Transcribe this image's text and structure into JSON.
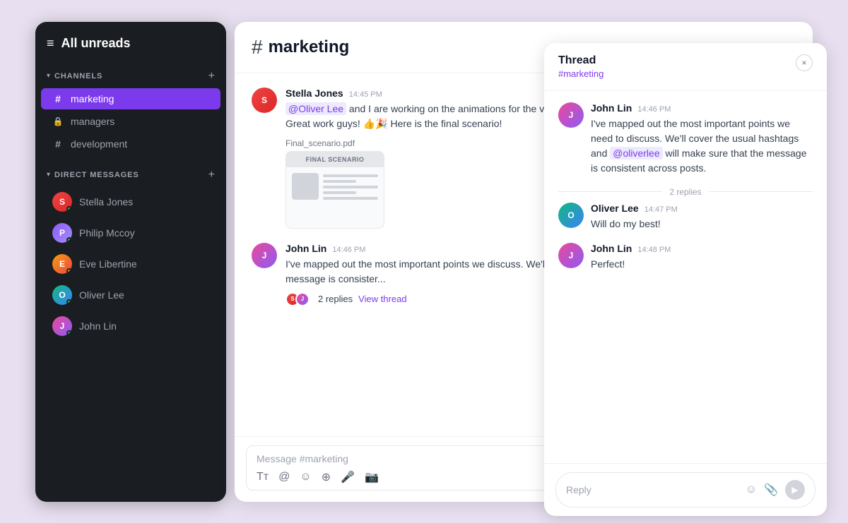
{
  "sidebar": {
    "title": "All unreads",
    "channels_label": "CHANNELS",
    "dm_label": "DIRECT MESSAGES",
    "channels": [
      {
        "name": "marketing",
        "icon": "#",
        "type": "public",
        "active": true
      },
      {
        "name": "managers",
        "icon": "🔒",
        "type": "private",
        "active": false
      },
      {
        "name": "development",
        "icon": "#",
        "type": "public",
        "active": false
      }
    ],
    "direct_messages": [
      {
        "name": "Stella Jones",
        "status": "online"
      },
      {
        "name": "Philip Mccoy",
        "status": "online"
      },
      {
        "name": "Eve Libertine",
        "status": "away"
      },
      {
        "name": "Oliver Lee",
        "status": "online"
      },
      {
        "name": "John Lin",
        "status": "online"
      }
    ]
  },
  "chat": {
    "channel_name": "marketing",
    "messages": [
      {
        "author": "Stella Jones",
        "time": "14:45 PM",
        "text": "@Oliver Lee and I are working on the animations for the video, and we are planning to finish it within two days. Great work guys! 👍🎉 Here is the final scenario!",
        "mention": "@Oliver Lee",
        "attachment": {
          "name": "Final_scenario.pdf",
          "header": "FINAL SCENARIO"
        },
        "avatar_class": "av-stella",
        "avatar_letter": "S"
      },
      {
        "author": "John Lin",
        "time": "14:46 PM",
        "text": "I've mapped out the most important points we discuss. We'll cover the usual hashtags and will make sure that the message is consister...",
        "avatar_class": "av-john2",
        "avatar_letter": "J",
        "replies_count": "2 replies",
        "view_thread": "View thread"
      }
    ],
    "input_placeholder": "Message #marketing"
  },
  "thread": {
    "title": "Thread",
    "channel": "#marketing",
    "messages": [
      {
        "author": "John Lin",
        "time": "14:46 PM",
        "text": "I've mapped out the most important points we need to discuss. We'll cover the usual hashtags and ",
        "mention": "@oliverlee",
        "text_after": " will make sure that the message is consistent across posts.",
        "avatar_class": "av-john2",
        "avatar_letter": "J"
      },
      {
        "author": "Oliver Lee",
        "time": "14:47 PM",
        "text": "Will do my best!",
        "avatar_class": "av-oliver",
        "avatar_letter": "O"
      },
      {
        "author": "John Lin",
        "time": "14:48 PM",
        "text": "Perfect!",
        "avatar_class": "av-john2",
        "avatar_letter": "J"
      }
    ],
    "replies_label": "2 replies",
    "input_placeholder": "Reply",
    "close_icon": "×"
  },
  "icons": {
    "hamburger": "≡",
    "chevron_down": "▾",
    "plus": "+",
    "hash": "#",
    "bold": "Tт",
    "at": "@",
    "emoji": "☺",
    "attachment": "⊕",
    "mic": "🎤",
    "video": "🎬",
    "send": "▶",
    "emoji_reaction": "☺",
    "paper_clip": "📎"
  }
}
